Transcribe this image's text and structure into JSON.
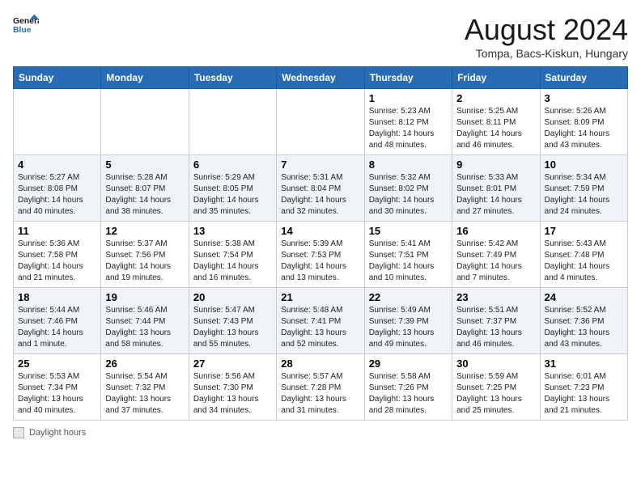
{
  "header": {
    "logo_general": "General",
    "logo_blue": "Blue",
    "month_title": "August 2024",
    "location": "Tompa, Bacs-Kiskun, Hungary"
  },
  "footer": {
    "label": "Daylight hours"
  },
  "days_of_week": [
    "Sunday",
    "Monday",
    "Tuesday",
    "Wednesday",
    "Thursday",
    "Friday",
    "Saturday"
  ],
  "weeks": [
    [
      {
        "day": "",
        "info": ""
      },
      {
        "day": "",
        "info": ""
      },
      {
        "day": "",
        "info": ""
      },
      {
        "day": "",
        "info": ""
      },
      {
        "day": "1",
        "info": "Sunrise: 5:23 AM\nSunset: 8:12 PM\nDaylight: 14 hours and 48 minutes."
      },
      {
        "day": "2",
        "info": "Sunrise: 5:25 AM\nSunset: 8:11 PM\nDaylight: 14 hours and 46 minutes."
      },
      {
        "day": "3",
        "info": "Sunrise: 5:26 AM\nSunset: 8:09 PM\nDaylight: 14 hours and 43 minutes."
      }
    ],
    [
      {
        "day": "4",
        "info": "Sunrise: 5:27 AM\nSunset: 8:08 PM\nDaylight: 14 hours and 40 minutes."
      },
      {
        "day": "5",
        "info": "Sunrise: 5:28 AM\nSunset: 8:07 PM\nDaylight: 14 hours and 38 minutes."
      },
      {
        "day": "6",
        "info": "Sunrise: 5:29 AM\nSunset: 8:05 PM\nDaylight: 14 hours and 35 minutes."
      },
      {
        "day": "7",
        "info": "Sunrise: 5:31 AM\nSunset: 8:04 PM\nDaylight: 14 hours and 32 minutes."
      },
      {
        "day": "8",
        "info": "Sunrise: 5:32 AM\nSunset: 8:02 PM\nDaylight: 14 hours and 30 minutes."
      },
      {
        "day": "9",
        "info": "Sunrise: 5:33 AM\nSunset: 8:01 PM\nDaylight: 14 hours and 27 minutes."
      },
      {
        "day": "10",
        "info": "Sunrise: 5:34 AM\nSunset: 7:59 PM\nDaylight: 14 hours and 24 minutes."
      }
    ],
    [
      {
        "day": "11",
        "info": "Sunrise: 5:36 AM\nSunset: 7:58 PM\nDaylight: 14 hours and 21 minutes."
      },
      {
        "day": "12",
        "info": "Sunrise: 5:37 AM\nSunset: 7:56 PM\nDaylight: 14 hours and 19 minutes."
      },
      {
        "day": "13",
        "info": "Sunrise: 5:38 AM\nSunset: 7:54 PM\nDaylight: 14 hours and 16 minutes."
      },
      {
        "day": "14",
        "info": "Sunrise: 5:39 AM\nSunset: 7:53 PM\nDaylight: 14 hours and 13 minutes."
      },
      {
        "day": "15",
        "info": "Sunrise: 5:41 AM\nSunset: 7:51 PM\nDaylight: 14 hours and 10 minutes."
      },
      {
        "day": "16",
        "info": "Sunrise: 5:42 AM\nSunset: 7:49 PM\nDaylight: 14 hours and 7 minutes."
      },
      {
        "day": "17",
        "info": "Sunrise: 5:43 AM\nSunset: 7:48 PM\nDaylight: 14 hours and 4 minutes."
      }
    ],
    [
      {
        "day": "18",
        "info": "Sunrise: 5:44 AM\nSunset: 7:46 PM\nDaylight: 14 hours and 1 minute."
      },
      {
        "day": "19",
        "info": "Sunrise: 5:46 AM\nSunset: 7:44 PM\nDaylight: 13 hours and 58 minutes."
      },
      {
        "day": "20",
        "info": "Sunrise: 5:47 AM\nSunset: 7:43 PM\nDaylight: 13 hours and 55 minutes."
      },
      {
        "day": "21",
        "info": "Sunrise: 5:48 AM\nSunset: 7:41 PM\nDaylight: 13 hours and 52 minutes."
      },
      {
        "day": "22",
        "info": "Sunrise: 5:49 AM\nSunset: 7:39 PM\nDaylight: 13 hours and 49 minutes."
      },
      {
        "day": "23",
        "info": "Sunrise: 5:51 AM\nSunset: 7:37 PM\nDaylight: 13 hours and 46 minutes."
      },
      {
        "day": "24",
        "info": "Sunrise: 5:52 AM\nSunset: 7:36 PM\nDaylight: 13 hours and 43 minutes."
      }
    ],
    [
      {
        "day": "25",
        "info": "Sunrise: 5:53 AM\nSunset: 7:34 PM\nDaylight: 13 hours and 40 minutes."
      },
      {
        "day": "26",
        "info": "Sunrise: 5:54 AM\nSunset: 7:32 PM\nDaylight: 13 hours and 37 minutes."
      },
      {
        "day": "27",
        "info": "Sunrise: 5:56 AM\nSunset: 7:30 PM\nDaylight: 13 hours and 34 minutes."
      },
      {
        "day": "28",
        "info": "Sunrise: 5:57 AM\nSunset: 7:28 PM\nDaylight: 13 hours and 31 minutes."
      },
      {
        "day": "29",
        "info": "Sunrise: 5:58 AM\nSunset: 7:26 PM\nDaylight: 13 hours and 28 minutes."
      },
      {
        "day": "30",
        "info": "Sunrise: 5:59 AM\nSunset: 7:25 PM\nDaylight: 13 hours and 25 minutes."
      },
      {
        "day": "31",
        "info": "Sunrise: 6:01 AM\nSunset: 7:23 PM\nDaylight: 13 hours and 21 minutes."
      }
    ]
  ]
}
